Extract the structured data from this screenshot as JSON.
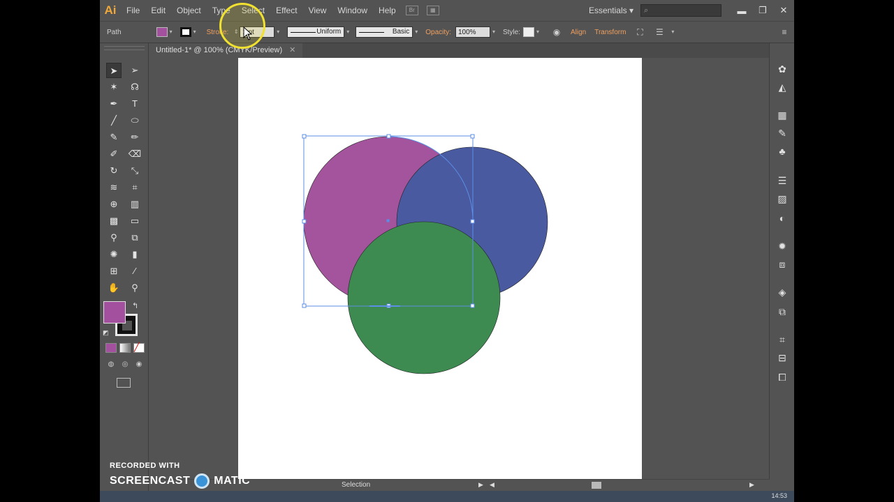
{
  "menubar": {
    "app_logo": "Ai",
    "items": [
      "File",
      "Edit",
      "Object",
      "Type",
      "Select",
      "Effect",
      "View",
      "Window",
      "Help"
    ],
    "bridge_icon": "Br",
    "workspace": "Essentials",
    "search_placeholder": ""
  },
  "controlbar": {
    "selection_type": "Path",
    "stroke_label": "Stroke:",
    "stroke_weight": "1 pt",
    "profile": "Uniform",
    "brush": "Basic",
    "opacity_label": "Opacity:",
    "opacity_value": "100%",
    "style_label": "Style:",
    "align_label": "Align",
    "transform_label": "Transform",
    "fill_color": "#a3509e"
  },
  "document": {
    "tab_title": "Untitled-1* @ 100% (CMYK/Preview)"
  },
  "tools": {
    "fill_color": "#a3509e",
    "stroke_color": "#111111"
  },
  "artwork": {
    "circles": [
      {
        "name": "magenta-circle",
        "color": "#a3549c"
      },
      {
        "name": "blue-circle",
        "color": "#4a5aa0"
      },
      {
        "name": "green-circle",
        "color": "#3d8b50"
      }
    ],
    "selection_color": "#5b8ee6"
  },
  "status": {
    "tool": "Selection"
  },
  "watermark": {
    "line1": "RECORDED WITH",
    "line2a": "SCREENCAST",
    "line2b": "MATIC"
  },
  "taskbar": {
    "clock": "14:53"
  }
}
